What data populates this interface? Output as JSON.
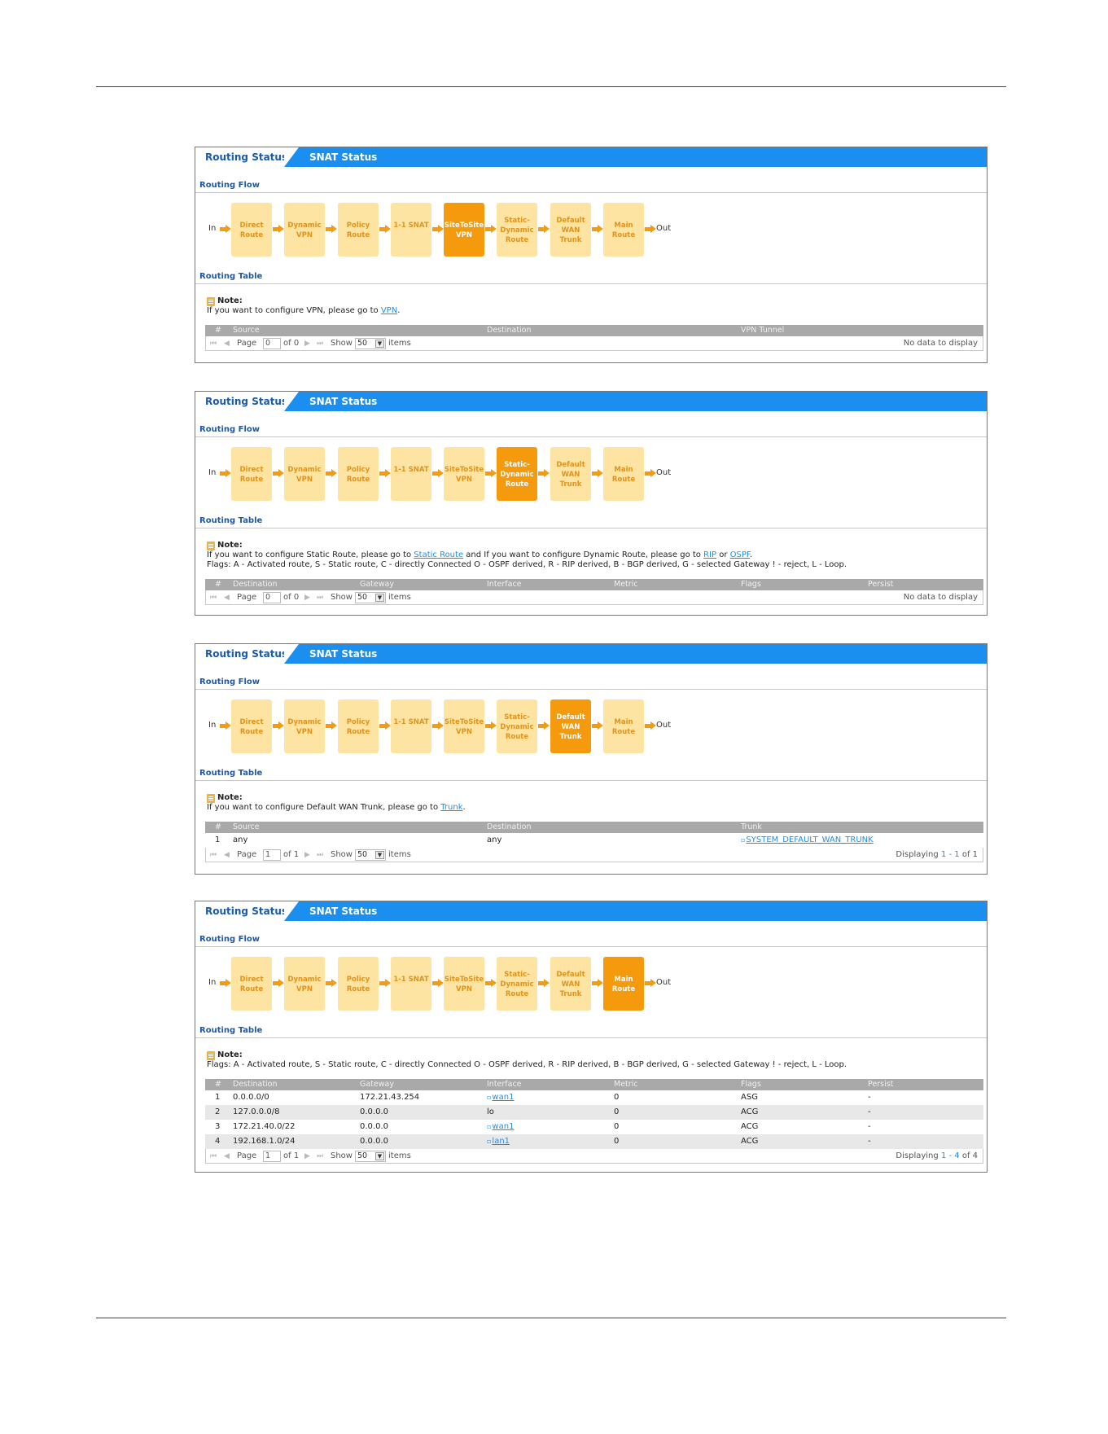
{
  "tabs": {
    "routing_status": "Routing Status",
    "snat_status": "SNAT Status"
  },
  "labels": {
    "routing_flow": "Routing Flow",
    "routing_table": "Routing Table",
    "in": "In",
    "out": "Out"
  },
  "flow_boxes": [
    [
      "Direct",
      "Route"
    ],
    [
      "Dynamic",
      "VPN"
    ],
    [
      "Policy",
      "Route"
    ],
    [
      "1-1 SNAT"
    ],
    [
      "SiteToSite",
      "VPN"
    ],
    [
      "Static-",
      "Dynamic",
      "Route"
    ],
    [
      "Default",
      "WAN",
      "Trunk"
    ],
    [
      "Main",
      "Route"
    ]
  ],
  "note_label": "Note:",
  "pager": {
    "page": "Page",
    "show": "Show",
    "items": "items",
    "show_value": "50"
  },
  "panels": [
    {
      "active_step": 4,
      "note_lines": [
        [
          {
            "t": "If you want to configure VPN, please go to "
          },
          {
            "t": "VPN",
            "link": true
          },
          {
            "t": "."
          }
        ]
      ],
      "columns": [
        "#",
        "Source",
        "Destination",
        "VPN Tunnel"
      ],
      "rows": [],
      "page_value": "0",
      "of_text": "of 0",
      "status": [
        {
          "t": "No data to display"
        }
      ]
    },
    {
      "active_step": 5,
      "note_lines": [
        [
          {
            "t": "If you want to configure Static Route, please go to "
          },
          {
            "t": "Static Route",
            "link": true
          },
          {
            "t": " and If you want to configure Dynamic Route, please go to "
          },
          {
            "t": "RIP",
            "link": true
          },
          {
            "t": " or "
          },
          {
            "t": "OSPF",
            "link": true
          },
          {
            "t": "."
          }
        ],
        [
          {
            "t": "Flags: A - Activated route, S - Static route, C - directly Connected O - OSPF derived, R - RIP derived, B - BGP derived, G - selected Gateway ! - reject, L - Loop."
          }
        ]
      ],
      "columns": [
        "#",
        "Destination",
        "Gateway",
        "Interface",
        "Metric",
        "Flags",
        "Persist"
      ],
      "rows": [],
      "page_value": "0",
      "of_text": "of 0",
      "status": [
        {
          "t": "No data to display"
        }
      ]
    },
    {
      "active_step": 6,
      "note_lines": [
        [
          {
            "t": "If you want to configure Default WAN Trunk, please go to "
          },
          {
            "t": "Trunk",
            "link": true
          },
          {
            "t": "."
          }
        ]
      ],
      "columns": [
        "#",
        "Source",
        "Destination",
        "Trunk"
      ],
      "rows": [
        [
          "1",
          "any",
          "any",
          "SYSTEM_DEFAULT_WAN_TRUNK"
        ]
      ],
      "link_cols": [
        3
      ],
      "page_value": "1",
      "of_text": "of 1",
      "status": [
        {
          "t": "Displaying "
        },
        {
          "t": "1 - 1",
          "hl": true
        },
        {
          "t": " of 1"
        }
      ]
    },
    {
      "active_step": 7,
      "note_lines": [
        [
          {
            "t": "Flags: A - Activated route, S - Static route, C - directly Connected O - OSPF derived, R - RIP derived, B - BGP derived, G - selected Gateway ! - reject, L - Loop."
          }
        ]
      ],
      "columns": [
        "#",
        "Destination",
        "Gateway",
        "Interface",
        "Metric",
        "Flags",
        "Persist"
      ],
      "rows": [
        [
          "1",
          "0.0.0.0/0",
          "172.21.43.254",
          "wan1",
          "0",
          "ASG",
          "-"
        ],
        [
          "2",
          "127.0.0.0/8",
          "0.0.0.0",
          "lo",
          "0",
          "ACG",
          "-"
        ],
        [
          "3",
          "172.21.40.0/22",
          "0.0.0.0",
          "wan1",
          "0",
          "ACG",
          "-"
        ],
        [
          "4",
          "192.168.1.0/24",
          "0.0.0.0",
          "lan1",
          "0",
          "ACG",
          "-"
        ]
      ],
      "link_cells": [
        [
          0,
          3
        ],
        [
          2,
          3
        ],
        [
          3,
          3
        ]
      ],
      "page_value": "1",
      "of_text": "of 1",
      "status": [
        {
          "t": "Displaying "
        },
        {
          "t": "1 - 4",
          "hl": true
        },
        {
          "t": " of 4"
        }
      ]
    }
  ]
}
